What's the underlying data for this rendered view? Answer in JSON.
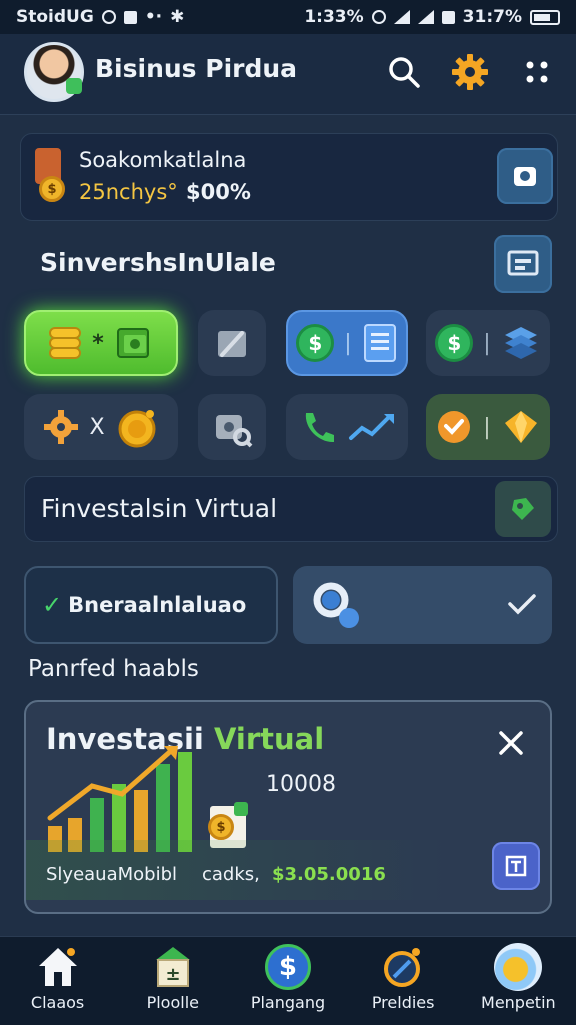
{
  "status_bar": {
    "left_text": "StoidUG",
    "time": "1:33%",
    "battery_text": "31:7%"
  },
  "header": {
    "title": "Bisinus Pirdua"
  },
  "promo_card": {
    "title": "Soakomkatlalna",
    "subtitle_left": "25nchys°",
    "subtitle_right": "$00%"
  },
  "section1": {
    "title": "SinvershsInUlale"
  },
  "tile_glyphs": {
    "tile1_mid": "*",
    "tile3_sep": "|",
    "tile4_sep": "|",
    "tile5_mid": "X",
    "tile8_sep": "|"
  },
  "investment_bar": {
    "title": "Finvestalsin Virtual"
  },
  "selection": {
    "left_label": "Bneraalnlaluao"
  },
  "section2": {
    "title": "Panrfed haabls"
  },
  "invest_card": {
    "title_white": "Investasii",
    "title_green": "Virtual",
    "value": "10008",
    "footer_left": "SlyeauaMobibl",
    "footer_mid": "cadks,",
    "footer_amount": "$3.05.0016"
  },
  "bottom_nav": [
    {
      "label": "Claaos",
      "icon": "home-icon"
    },
    {
      "label": "Ploolle",
      "icon": "building-icon"
    },
    {
      "label": "Plangang",
      "icon": "dollar-coin-icon"
    },
    {
      "label": "Preldies",
      "icon": "compass-icon"
    },
    {
      "label": "Menpetin",
      "icon": "profile-orb-icon"
    }
  ]
}
